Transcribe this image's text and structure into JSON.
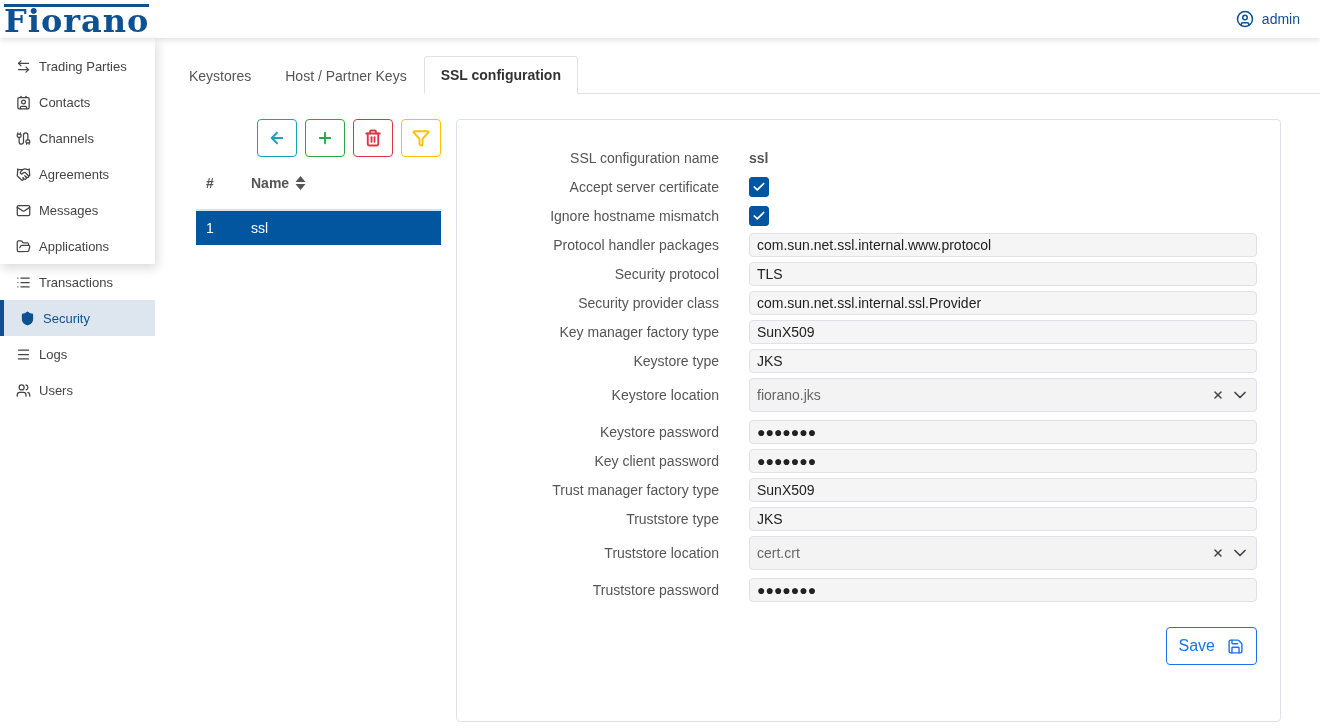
{
  "header": {
    "logo": "Fiorano",
    "user": "admin"
  },
  "sidebar": {
    "items": [
      {
        "label": "Trading Parties",
        "selected": false
      },
      {
        "label": "Contacts",
        "selected": false
      },
      {
        "label": "Channels",
        "selected": false
      },
      {
        "label": "Agreements",
        "selected": false
      },
      {
        "label": "Messages",
        "selected": false
      },
      {
        "label": "Applications",
        "selected": false
      },
      {
        "label": "Transactions",
        "selected": false
      },
      {
        "label": "Security",
        "selected": true
      },
      {
        "label": "Logs",
        "selected": false
      },
      {
        "label": "Users",
        "selected": false
      }
    ]
  },
  "tabs": [
    {
      "label": "Keystores",
      "selected": false
    },
    {
      "label": "Host / Partner Keys",
      "selected": false
    },
    {
      "label": "SSL configuration",
      "selected": true
    }
  ],
  "toolbar": [
    {
      "kind": "back"
    },
    {
      "kind": "add"
    },
    {
      "kind": "delete"
    },
    {
      "kind": "filter"
    }
  ],
  "table": {
    "columns": [
      "#",
      "Name"
    ],
    "rows": [
      {
        "cells": [
          "1",
          "ssl"
        ],
        "selected": true
      }
    ]
  },
  "form": {
    "fields": [
      {
        "kind": "text",
        "label": "SSL configuration name",
        "value": "ssl"
      },
      {
        "kind": "checkbox",
        "label": "Accept server certificate",
        "checked": true
      },
      {
        "kind": "checkbox",
        "label": "Ignore hostname mismatch",
        "checked": true
      },
      {
        "kind": "input",
        "label": "Protocol handler packages",
        "value": "com.sun.net.ssl.internal.www.protocol"
      },
      {
        "kind": "input",
        "label": "Security protocol",
        "value": "TLS"
      },
      {
        "kind": "input",
        "label": "Security provider class",
        "value": "com.sun.net.ssl.internal.ssl.Provider"
      },
      {
        "kind": "input",
        "label": "Key manager factory type",
        "value": "SunX509"
      },
      {
        "kind": "input",
        "label": "Keystore type",
        "value": "JKS"
      },
      {
        "kind": "select",
        "label": "Keystore location",
        "value": "fiorano.jks"
      },
      {
        "kind": "input",
        "label": "Keystore password",
        "value": "●●●●●●●"
      },
      {
        "kind": "input",
        "label": "Key client password",
        "value": "●●●●●●●"
      },
      {
        "kind": "input",
        "label": "Trust manager factory type",
        "value": "SunX509"
      },
      {
        "kind": "input",
        "label": "Truststore type",
        "value": "JKS"
      },
      {
        "kind": "select",
        "label": "Truststore location",
        "value": "cert.crt"
      },
      {
        "kind": "input",
        "label": "Truststore password",
        "value": "●●●●●●●"
      }
    ],
    "save": "Save"
  }
}
